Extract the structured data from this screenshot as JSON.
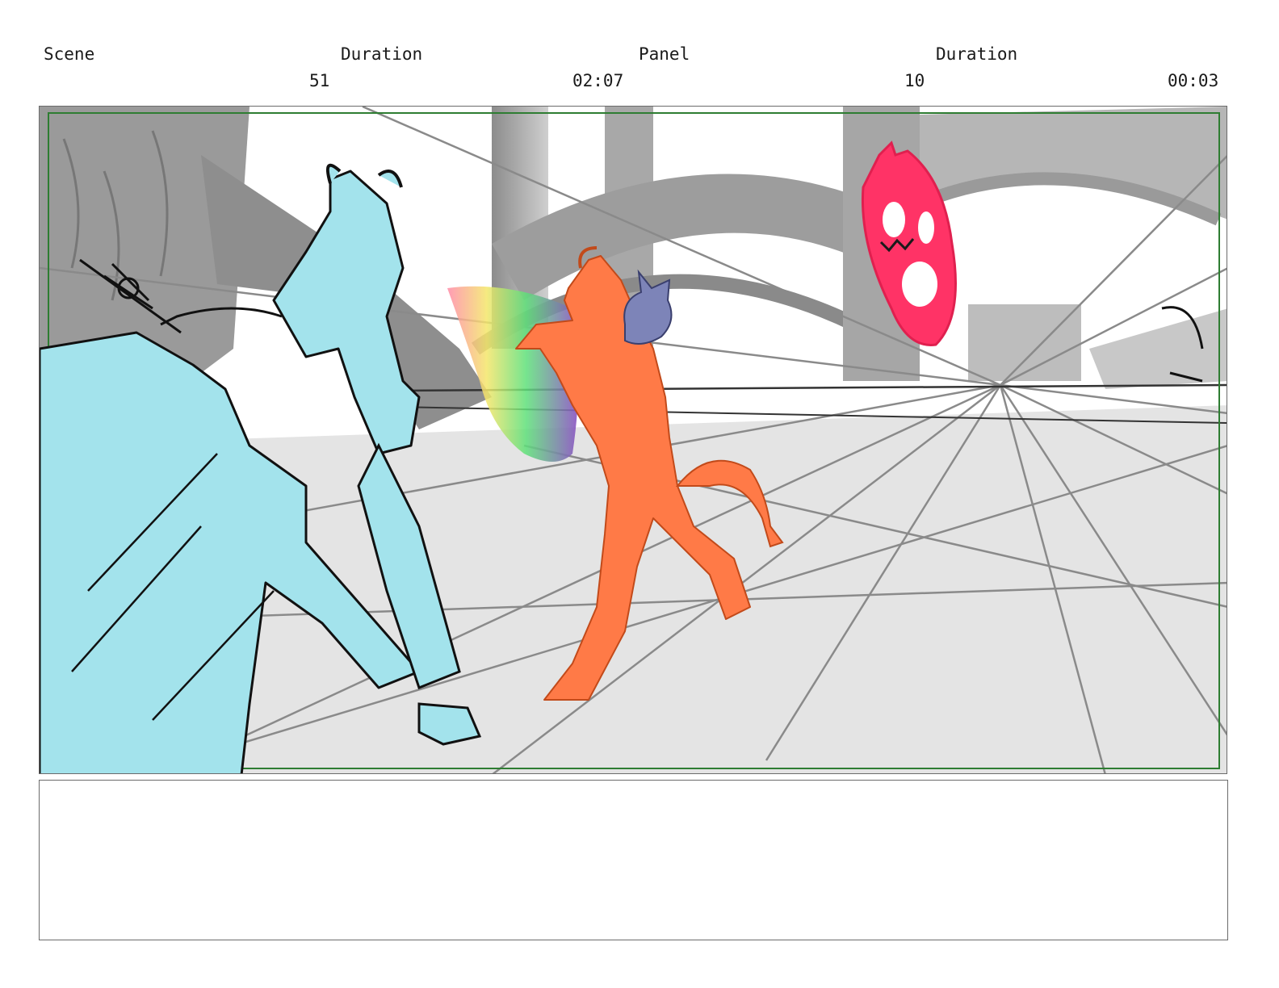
{
  "header": {
    "scene_label": "Scene",
    "scene_duration_label": "Duration",
    "panel_label": "Panel",
    "panel_duration_label": "Duration",
    "scene_number": "51",
    "scene_duration": "02:07",
    "panel_number": "10",
    "panel_duration": "00:03"
  },
  "artwork": {
    "safe_frame_color": "#2e7d32",
    "floor_color": "#e4e4e4",
    "tall_figure_color": "#a3e3ec",
    "running_figure_color": "#ff7a47",
    "small_creature_color": "#7d84b8",
    "floating_mask_color": "#ff3366"
  },
  "notes": {
    "text": ""
  }
}
